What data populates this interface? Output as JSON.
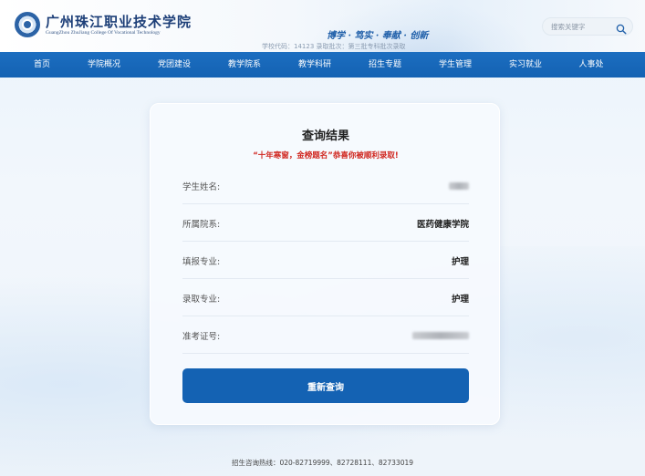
{
  "header": {
    "school_name": "广州珠江职业技术学院",
    "school_name_en": "GuangZhou ZhuJiang College Of Vocational Technology",
    "motto": "博学 · 笃实 · 奉献 · 创新",
    "school_meta": "学校代码：14123  录取批次：第三批专科批次录取",
    "search_placeholder": "搜索关键字",
    "search_icon": "search-icon"
  },
  "nav": {
    "items": [
      {
        "label": "首页"
      },
      {
        "label": "学院概况"
      },
      {
        "label": "党团建设"
      },
      {
        "label": "教学院系"
      },
      {
        "label": "教学科研"
      },
      {
        "label": "招生专题"
      },
      {
        "label": "学生管理"
      },
      {
        "label": "实习就业"
      },
      {
        "label": "人事处"
      }
    ]
  },
  "result": {
    "title": "查询结果",
    "subtitle": "“十年寒窗，金榜题名”恭喜你被顺利录取!",
    "rows": [
      {
        "label": "学生姓名:",
        "value": ""
      },
      {
        "label": "所属院系:",
        "value": "医药健康学院"
      },
      {
        "label": "填报专业:",
        "value": "护理"
      },
      {
        "label": "录取专业:",
        "value": "护理"
      },
      {
        "label": "准考证号:",
        "value": ""
      }
    ],
    "requery_label": "重新查询"
  },
  "footer": {
    "hotline": "招生咨询热线：020-82719999、82728111、82733019"
  },
  "colors": {
    "primary": "#1462b3",
    "accent_red": "#d0261f"
  }
}
